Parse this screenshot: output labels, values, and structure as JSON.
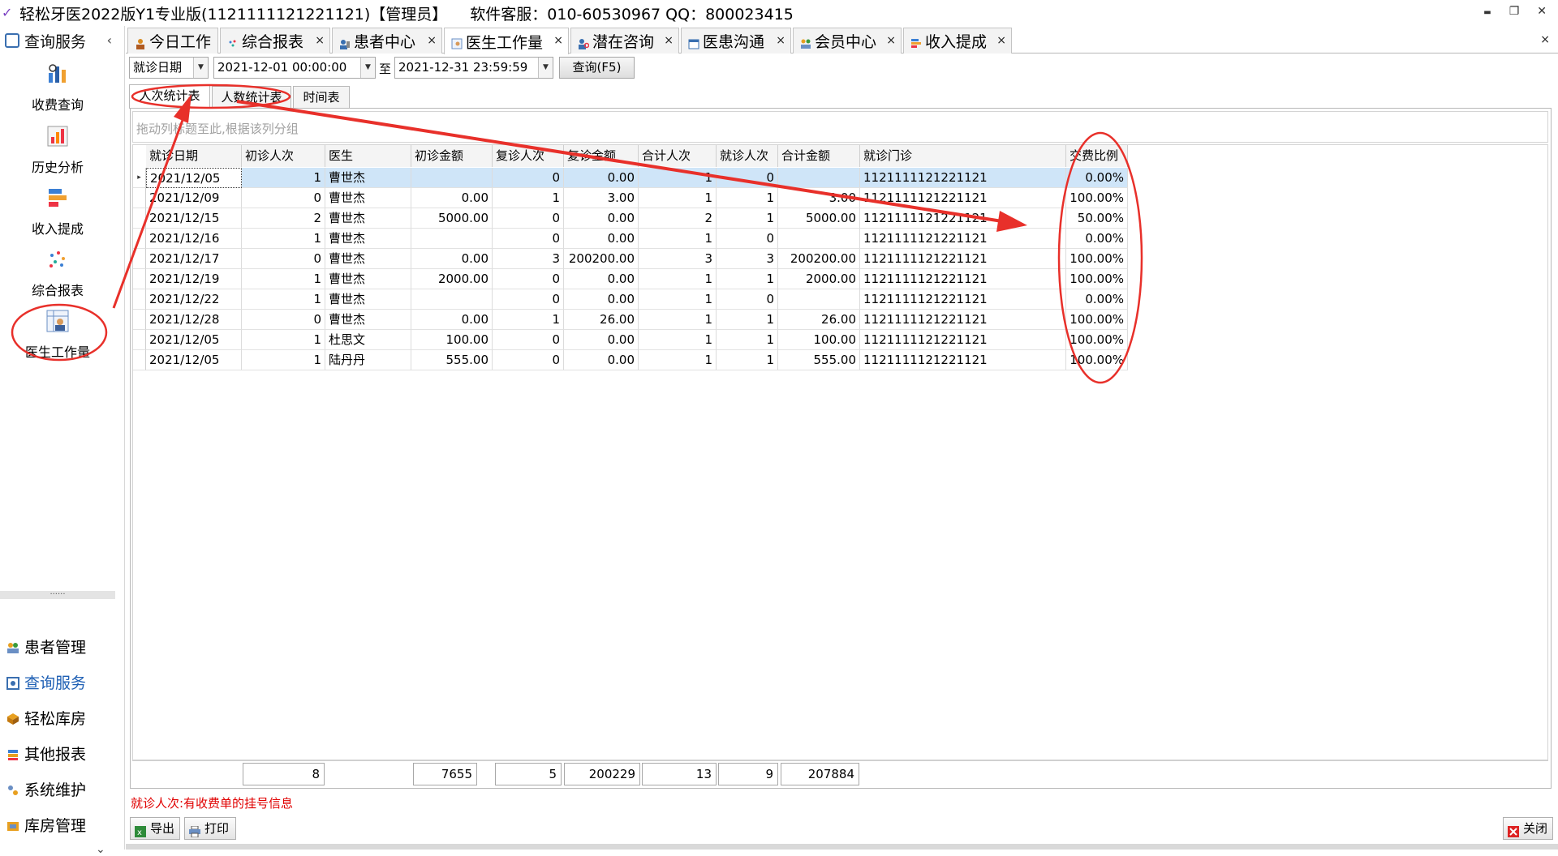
{
  "window": {
    "title": "轻松牙医2022版Y1专业版(1121111121221121)【管理员】",
    "service": "软件客服：010-60530967 QQ：800023415",
    "min": "▬",
    "restore": "❐",
    "close": "✕"
  },
  "sidebar": {
    "header": "查询服务",
    "collapse": "‹",
    "nav": [
      {
        "label": "收费查询",
        "icon": "bar-chart-icon"
      },
      {
        "label": "历史分析",
        "icon": "analysis-icon"
      },
      {
        "label": "收入提成",
        "icon": "stacked-bars-icon"
      },
      {
        "label": "综合报表",
        "icon": "scatter-icon"
      },
      {
        "label": "医生工作量",
        "icon": "doctor-workload-icon"
      }
    ],
    "divider": "......",
    "modules": [
      {
        "label": "患者管理"
      },
      {
        "label": "查询服务"
      },
      {
        "label": "轻松库房"
      },
      {
        "label": "其他报表"
      },
      {
        "label": "系统维护"
      },
      {
        "label": "库房管理"
      }
    ],
    "down": "⌄"
  },
  "tabs": [
    {
      "label": "今日工作"
    },
    {
      "label": "综合报表"
    },
    {
      "label": "患者中心"
    },
    {
      "label": "医生工作量"
    },
    {
      "label": "潜在咨询"
    },
    {
      "label": "医患沟通"
    },
    {
      "label": "会员中心"
    },
    {
      "label": "收入提成"
    }
  ],
  "tab_close": "×",
  "tabs_close_all": "×",
  "filter": {
    "date_type": "就诊日期",
    "start": "2021-12-01 00:00:00",
    "to_label": "至",
    "end": "2021-12-31 23:59:59",
    "query_button": "查询(F5)",
    "dropdown_arrow": "▼"
  },
  "subtabs": [
    "人次统计表",
    "人数统计表",
    "时间表"
  ],
  "group_panel_hint": "拖动列标题至此,根据该列分组",
  "grid": {
    "columns": [
      "就诊日期",
      "初诊人次",
      "医生",
      "初诊金额",
      "复诊人次",
      "复诊金额",
      "合计人次",
      "就诊人次",
      "合计金额",
      "就诊门诊",
      "交费比例"
    ],
    "rows": [
      [
        "2021/12/05",
        "1",
        "曹世杰",
        "",
        "0",
        "0.00",
        "1",
        "0",
        "",
        "1121111121221121",
        "0.00%"
      ],
      [
        "2021/12/09",
        "0",
        "曹世杰",
        "0.00",
        "1",
        "3.00",
        "1",
        "1",
        "3.00",
        "1121111121221121",
        "100.00%"
      ],
      [
        "2021/12/15",
        "2",
        "曹世杰",
        "5000.00",
        "0",
        "0.00",
        "2",
        "1",
        "5000.00",
        "1121111121221121",
        "50.00%"
      ],
      [
        "2021/12/16",
        "1",
        "曹世杰",
        "",
        "0",
        "0.00",
        "1",
        "0",
        "",
        "1121111121221121",
        "0.00%"
      ],
      [
        "2021/12/17",
        "0",
        "曹世杰",
        "0.00",
        "3",
        "200200.00",
        "3",
        "3",
        "200200.00",
        "1121111121221121",
        "100.00%"
      ],
      [
        "2021/12/19",
        "1",
        "曹世杰",
        "2000.00",
        "0",
        "0.00",
        "1",
        "1",
        "2000.00",
        "1121111121221121",
        "100.00%"
      ],
      [
        "2021/12/22",
        "1",
        "曹世杰",
        "",
        "0",
        "0.00",
        "1",
        "0",
        "",
        "1121111121221121",
        "0.00%"
      ],
      [
        "2021/12/28",
        "0",
        "曹世杰",
        "0.00",
        "1",
        "26.00",
        "1",
        "1",
        "26.00",
        "1121111121221121",
        "100.00%"
      ],
      [
        "2021/12/05",
        "1",
        "杜思文",
        "100.00",
        "0",
        "0.00",
        "1",
        "1",
        "100.00",
        "1121111121221121",
        "100.00%"
      ],
      [
        "2021/12/05",
        "1",
        "陆丹丹",
        "555.00",
        "0",
        "0.00",
        "1",
        "1",
        "555.00",
        "1121111121221121",
        "100.00%"
      ]
    ],
    "row_indicator": "▸",
    "totals": {
      "first_visits": "8",
      "first_amount": "7655",
      "return_visits": "5",
      "return_amount": "200229",
      "total_visits": "13",
      "visits": "9",
      "total_amount": "207884"
    }
  },
  "note": "就诊人次:有收费单的挂号信息",
  "buttons": {
    "export": "导出",
    "print": "打印",
    "close": "关闭"
  },
  "annotation_color": "#e8302a"
}
